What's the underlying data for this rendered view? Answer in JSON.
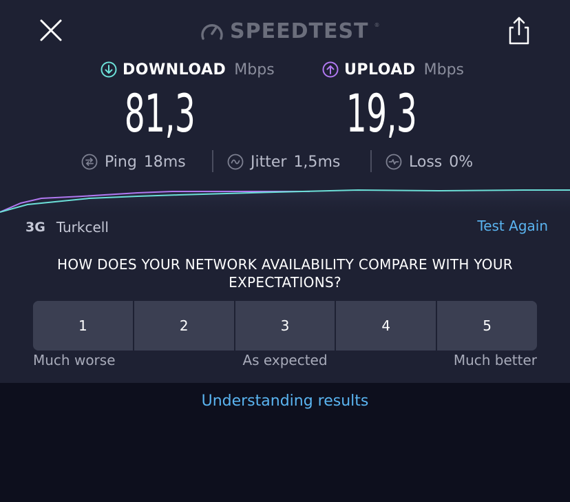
{
  "header": {
    "brand": "SPEEDTEST",
    "close_icon": "close-icon",
    "share_icon": "share-icon"
  },
  "download": {
    "label": "DOWNLOAD",
    "unit": "Mbps",
    "value": "81,3",
    "color": "#6ce0d8"
  },
  "upload": {
    "label": "UPLOAD",
    "unit": "Mbps",
    "value": "19,3",
    "color": "#b078f0"
  },
  "stats": {
    "ping": {
      "label": "Ping",
      "value": "18",
      "unit": "ms"
    },
    "jitter": {
      "label": "Jitter",
      "value": "1,5",
      "unit": "ms"
    },
    "loss": {
      "label": "Loss",
      "value": "0%"
    }
  },
  "connection": {
    "type": "3G",
    "isp": "Turkcell"
  },
  "test_again": "Test Again",
  "survey": {
    "question": "HOW DOES YOUR NETWORK AVAILABILITY COMPARE WITH YOUR EXPECTATIONS?",
    "options": [
      "1",
      "2",
      "3",
      "4",
      "5"
    ],
    "low_label": "Much worse",
    "mid_label": "As expected",
    "high_label": "Much better"
  },
  "understanding_results": "Understanding results",
  "colors": {
    "accent": "#5ab4f0",
    "download_line": "#6ce0d8",
    "upload_line": "#b078f0",
    "panel": "#1e2133",
    "background": "#0d0f1d"
  }
}
